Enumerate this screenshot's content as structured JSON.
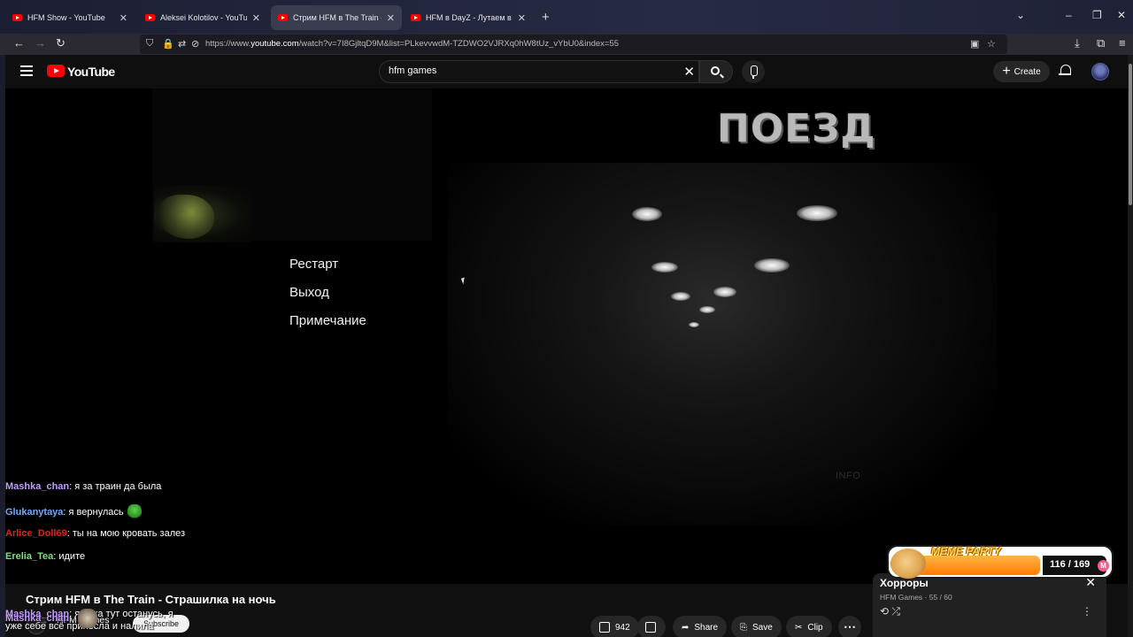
{
  "browser": {
    "tabs": [
      {
        "title": "HFM Show - YouTube",
        "active": false
      },
      {
        "title": "Aleksei Kolotilov - YouTube",
        "active": false
      },
      {
        "title": "Стрим HFM в The Train - Страшилка на ночь",
        "active": true
      },
      {
        "title": "HFM в DayZ - Лутаем в Электро",
        "active": false
      }
    ],
    "url_prefix": "https://www.",
    "url_domain": "youtube.com",
    "url_path": "/watch?v=7I8GjltqD9M&list=PLkevvwdM-TZDWO2VJRXq0hW8tUz_vYbU0&index=55"
  },
  "youtube": {
    "logo_text": "YouTube",
    "search_value": "hfm games",
    "create_label": "Create"
  },
  "game": {
    "title": "ПОЕЗД",
    "menu": [
      "Рестарт",
      "Выход",
      "Примечание"
    ],
    "info": "INFO"
  },
  "chat": [
    {
      "user": "Mashka_chan",
      "color": "#c39cff",
      "text": "я за траин да была",
      "emote": ""
    },
    {
      "user": "Glukanytaya",
      "color": "#6fa9ff",
      "text": "я вернулась",
      "emote": "frog"
    },
    {
      "user": "Arlice_Doll69",
      "color": "#e02020",
      "text": "ты на мою кровать залез",
      "emote": ""
    },
    {
      "user": "Erelia_Tea",
      "color": "#7ee081",
      "text": "идите",
      "emote": ""
    },
    {
      "user": "Mashka_chan",
      "color": "#c39cff",
      "text": "я пока тут останусь, я",
      "emote": ""
    },
    {
      "user": "",
      "color": "#ffffff",
      "text": "уже себе всё принесла и налила",
      "emote": ""
    },
    {
      "user": "Mashka_chan",
      "color": "#c39cff",
      "text": "",
      "emote": "cat"
    }
  ],
  "video": {
    "title": "Стрим HFM в The Train - Страшилка на ночь",
    "channel": "HFM Games",
    "subscribe_label": "Subscribe",
    "likes": "942",
    "share_label": "Share",
    "save_label": "Save",
    "clip_label": "Clip"
  },
  "playlist": {
    "title": "Хорроры",
    "owner": "HFM Games",
    "position": "55 / 60"
  },
  "meme_party": {
    "label": "MEME PARTY",
    "count": "116 / 169",
    "progress": 0.686
  }
}
